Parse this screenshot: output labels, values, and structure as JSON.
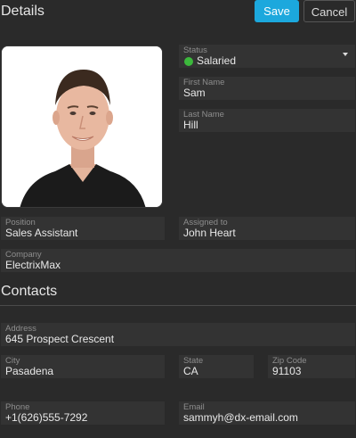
{
  "header": {
    "title": "Details",
    "save_label": "Save",
    "cancel_label": "Cancel"
  },
  "details": {
    "status": {
      "label": "Status",
      "value": "Salaried",
      "color": "#3cb83c"
    },
    "first_name": {
      "label": "First Name",
      "value": "Sam"
    },
    "last_name": {
      "label": "Last Name",
      "value": "Hill"
    },
    "position": {
      "label": "Position",
      "value": "Sales Assistant"
    },
    "assigned_to": {
      "label": "Assigned to",
      "value": "John Heart"
    },
    "company": {
      "label": "Company",
      "value": "ElectrixMax"
    }
  },
  "contacts": {
    "title": "Contacts",
    "address": {
      "label": "Address",
      "value": "645 Prospect Crescent"
    },
    "city": {
      "label": "City",
      "value": "Pasadena"
    },
    "state": {
      "label": "State",
      "value": "CA"
    },
    "zip": {
      "label": "Zip Code",
      "value": "91103"
    },
    "phone": {
      "label": "Phone",
      "value": "+1(626)555-7292"
    },
    "email": {
      "label": "Email",
      "value": "sammyh@dx-email.com"
    }
  },
  "colors": {
    "accent": "#1ca8dd",
    "background": "#2a2a2a",
    "field": "#333333"
  }
}
